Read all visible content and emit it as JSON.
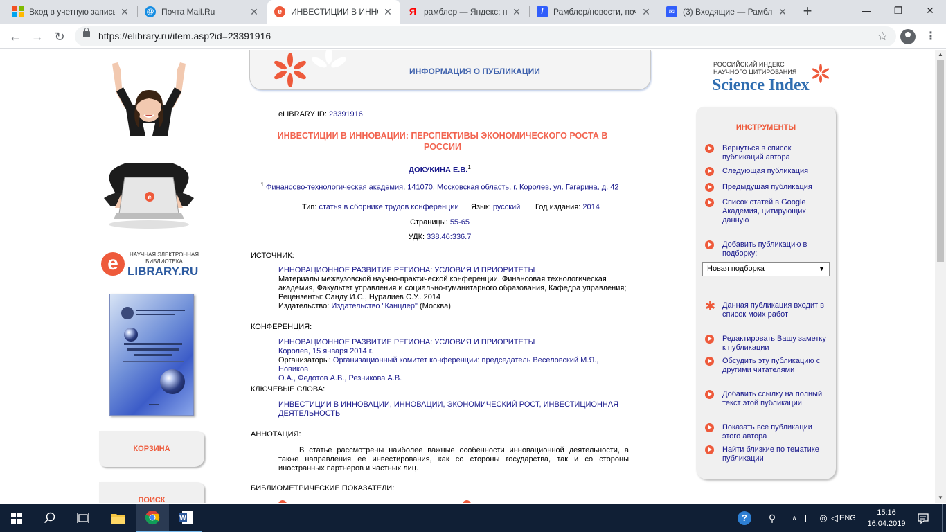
{
  "browser": {
    "tabs": [
      {
        "title": "Вход в учетную запись",
        "icon": "microsoft-logo-icon",
        "active": false
      },
      {
        "title": "Почта Mail.Ru",
        "icon": "mailru-at-icon",
        "active": false
      },
      {
        "title": "ИНВЕСТИЦИИ В ИННОВ",
        "icon": "elibrary-e-icon",
        "active": true
      },
      {
        "title": "рамблер — Яндекс: на",
        "icon": "yandex-y-icon",
        "active": false
      },
      {
        "title": "Рамблер/новости, поч",
        "icon": "rambler-slash-icon",
        "active": false
      },
      {
        "title": "(3) Входящие — Рамбл",
        "icon": "envelope-icon",
        "active": false
      }
    ],
    "url": "https://elibrary.ru/item.asp?id=23391916"
  },
  "left": {
    "elib_caption": "НАУЧНАЯ ЭЛЕКТРОННАЯ БИБЛИОТЕКА",
    "elib_e": "e",
    "elib_name": "LIBRARY.RU",
    "cart": "КОРЗИНА",
    "search": "ПОИСК"
  },
  "header": {
    "title": "ИНФОРМАЦИЯ О ПУБЛИКАЦИИ"
  },
  "pub": {
    "id_label": "eLIBRARY ID:",
    "id_value": "23391916",
    "title": "ИНВЕСТИЦИИ В ИННОВАЦИИ: ПЕРСПЕКТИВЫ ЭКОНОМИЧЕСКОГО РОСТА В РОССИИ",
    "author": "ДОКУКИНА Е.В.",
    "author_sup": "1",
    "affil_sup": "1",
    "affiliation": "Финансово-технологическая академия, 141070, Московская область, г. Королев, ул. Гагарина, д. 42",
    "type_label": "Тип:",
    "type_value": "статья в сборнике трудов конференции",
    "lang_label": "Язык:",
    "lang_value": "русский",
    "year_label": "Год издания:",
    "year_value": "2014",
    "pages_label": "Страницы:",
    "pages_value": "55-65",
    "udk_label": "УДК:",
    "udk_value": "338.46:336.7",
    "source_label": "ИСТОЧНИК:",
    "source_title": "ИННОВАЦИОННОЕ РАЗВИТИЕ РЕГИОНА: УСЛОВИЯ И ПРИОРИТЕТЫ",
    "source_line1": "Материалы межвузовской научно-практической конференции. Финансовая технологическая",
    "source_line2": "академия, Факультет управления и социально-гуманитарного образования, Кафедра управления;",
    "source_line3": "Рецензенты: Санду И.С., Нуралиев С.У.. 2014",
    "publisher_label": "Издательство:",
    "publisher_value": "Издательство \"Канцлер\"",
    "publisher_city": "(Москва)",
    "conf_label": "КОНФЕРЕНЦИЯ:",
    "conf_title": "ИННОВАЦИОННОЕ РАЗВИТИЕ РЕГИОНА: УСЛОВИЯ И ПРИОРИТЕТЫ",
    "conf_place": "Королев, 15 января 2014 г.",
    "org_label": "Организаторы:",
    "org_line1": "Организационный комитет конференции: председатель Веселовский М.Я., Новиков",
    "org_line2": "О.А., Федотов А.В., Резникова А.В.",
    "kw_label": "КЛЮЧЕВЫЕ СЛОВА:",
    "kw_line1": "ИНВЕСТИЦИИ В ИННОВАЦИИ, ИННОВАЦИИ, ЭКОНОМИЧЕСКИЙ РОСТ, ИНВЕСТИЦИОННАЯ",
    "kw_line2": "ДЕЯТЕЛЬНОСТЬ",
    "abs_label": "АННОТАЦИЯ:",
    "abs_text": "В статье рассмотрены наиболее важные особенности инновационной деятельности, а также направления ее инвестирования, как со стороны государства, так и со стороны иностранных партнеров и частных лиц.",
    "biblio_label": "БИБЛИОМЕТРИЧЕСКИЕ ПОКАЗАТЕЛИ:"
  },
  "right": {
    "si_caption1": "РОССИЙСКИЙ ИНДЕКС",
    "si_caption2": "НАУЧНОГО ЦИТИРОВАНИЯ",
    "si_name": "Science Index",
    "tools_title": "ИНСТРУМЕНТЫ",
    "tools": [
      "Вернуться в список публикаций автора",
      "Следующая публикация",
      "Предыдущая публикация",
      "Список статей в Google Академия, цитирующих данную",
      "Добавить публикацию в подборку:",
      "Данная публикация входит в список моих работ",
      "Редактировать Вашу заметку к публикации",
      "Обсудить эту публикацию с другими читателями",
      "Добавить ссылку на полный текст этой публикации",
      "Показать все публикации этого автора",
      "Найти близкие по тематике публикации"
    ],
    "select_value": "Новая подборка"
  },
  "taskbar": {
    "lang": "ENG",
    "time": "15:16",
    "date": "16.04.2019"
  },
  "colors": {
    "accent": "#ee5a3b",
    "link": "#1a1a8c",
    "header_blue": "#3f62ad"
  }
}
